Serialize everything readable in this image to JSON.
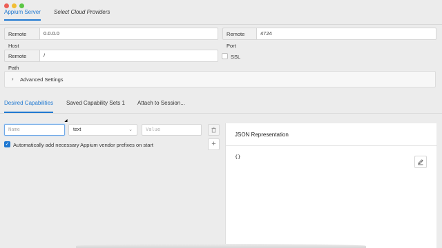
{
  "window": {
    "tabs": [
      "Appium Server",
      "Select Cloud Providers"
    ]
  },
  "server": {
    "remote_host_label": "Remote Host",
    "remote_host_value": "0.0.0.0",
    "remote_port_label": "Remote Port",
    "remote_port_value": "4724",
    "remote_path_label": "Remote Path",
    "remote_path_value": "/",
    "ssl_label": "SSL",
    "ssl_checked": false
  },
  "advanced": {
    "title": "Advanced Settings",
    "expanded": false
  },
  "subtabs": [
    "Desired Capabilities",
    "Saved Capability Sets 1",
    "Attach to Session..."
  ],
  "capability": {
    "name_placeholder": "Name",
    "type_value": "text",
    "value_placeholder": "Value",
    "auto_prefix_label": "Automatically add necessary Appium vendor prefixes on start",
    "auto_prefix_checked": true
  },
  "json_panel": {
    "title": "JSON Representation",
    "content": "{}"
  },
  "colors": {
    "accent": "#1f78d1"
  }
}
